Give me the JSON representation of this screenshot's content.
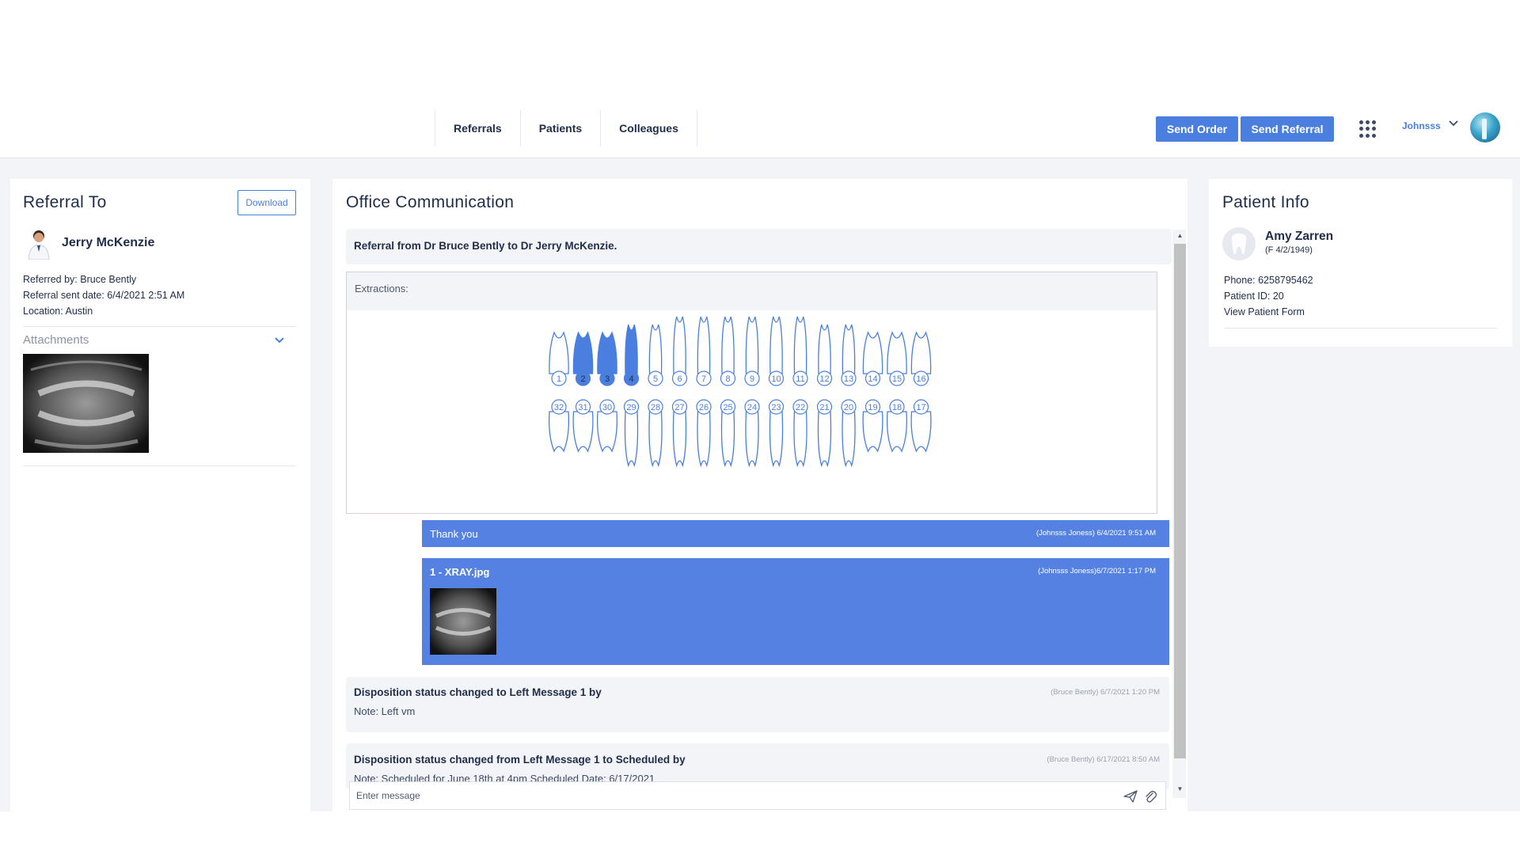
{
  "nav": {
    "items": [
      "Referrals",
      "Patients",
      "Colleagues"
    ],
    "send_order": "Send Order",
    "send_referral": "Send Referral",
    "user": "Johnsss"
  },
  "referral": {
    "title": "Referral To",
    "download": "Download",
    "doctor": "Jerry McKenzie",
    "referred_by": "Referred by: Bruce Bently",
    "sent_date": "Referral sent date: 6/4/2021 2:51 AM",
    "location": "Location: Austin",
    "attachments": "Attachments"
  },
  "comm": {
    "title": "Office Communication",
    "header_msg": "Referral from Dr Bruce Bently to Dr Jerry McKenzie.",
    "extractions_label": "Extractions:",
    "upper_teeth": [
      "1",
      "2",
      "3",
      "4",
      "5",
      "6",
      "7",
      "8",
      "9",
      "10",
      "11",
      "12",
      "13",
      "14",
      "15",
      "16"
    ],
    "lower_teeth": [
      "32",
      "31",
      "30",
      "29",
      "28",
      "27",
      "26",
      "25",
      "24",
      "23",
      "22",
      "21",
      "20",
      "19",
      "18",
      "17"
    ],
    "extracted": [
      "2",
      "3",
      "4"
    ],
    "messages": [
      {
        "text": "Thank you",
        "ts": "(Johnsss Joness) 6/4/2021 9:51 AM"
      },
      {
        "text": "1 - XRAY.jpg",
        "ts": "(Johnsss Joness)6/7/2021 1:17 PM"
      }
    ],
    "statuses": [
      {
        "title": "Disposition status changed to Left Message 1 by",
        "ts": "(Bruce Bently) 6/7/2021 1:20 PM",
        "note": "Note: Left vm"
      },
      {
        "title": "Disposition status changed from Left Message 1 to Scheduled by",
        "ts": "(Bruce Bently) 6/17/2021 8:50 AM",
        "note": "Note: Scheduled for June 18th at 4pm Scheduled Date: 6/17/2021"
      }
    ],
    "input_placeholder": "Enter message"
  },
  "patient": {
    "title": "Patient Info",
    "name": "Amy Zarren",
    "sub": "(F 4/2/1949)",
    "phone": "Phone: 6258795462",
    "pid": "Patient ID: 20",
    "form_link": "View Patient Form"
  },
  "colors": {
    "accent": "#4a7fe0",
    "message_blue": "#5582e2",
    "text": "#1f2d4a"
  }
}
